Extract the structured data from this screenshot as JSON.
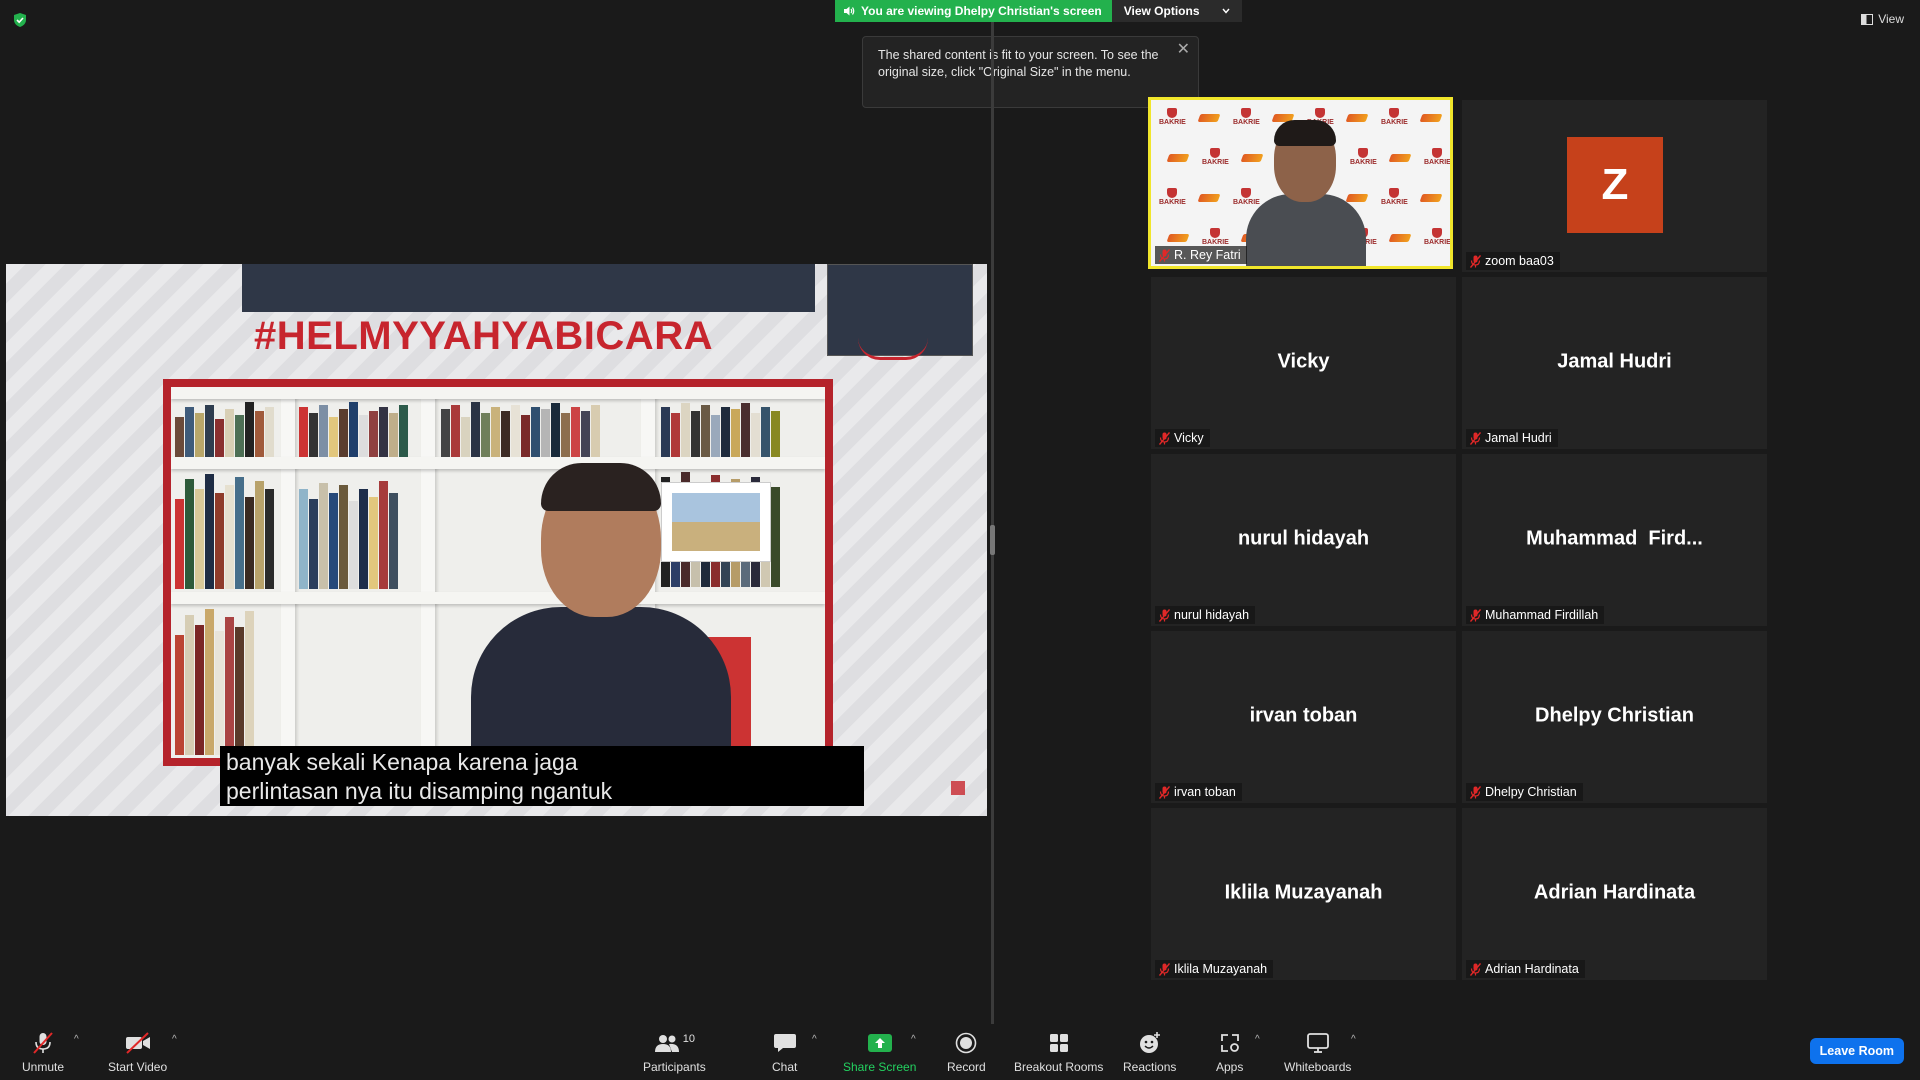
{
  "top": {
    "viewing_text": "You are viewing Dhelpy Christian's screen",
    "view_options_label": "View Options",
    "view_label": "View",
    "accent_green": "#23b14d"
  },
  "tooltip": {
    "text": "The shared content is fit to your screen. To see the original size, click \"Original Size\" in the menu."
  },
  "shared_screen": {
    "hashtag": "#HELMYYAHYABICARA",
    "caption_line1": "banyak sekali Kenapa karena jaga",
    "caption_line2": "perlintasan nya itu disamping ngantuk",
    "accent_red": "#c7252e"
  },
  "gallery": {
    "tiles": [
      {
        "center_name": "",
        "label": "R. Rey Fatri",
        "active": true,
        "video": true
      },
      {
        "center_name": "",
        "label": "zoom baa03",
        "avatar_letter": "Z",
        "avatar_color": "#c6411b"
      },
      {
        "center_name": "Vicky",
        "label": "Vicky"
      },
      {
        "center_name": "Jamal Hudri",
        "label": "Jamal Hudri"
      },
      {
        "center_name": "nurul hidayah",
        "label": "nurul hidayah"
      },
      {
        "center_name": "Muhammad  Fird...",
        "label": "Muhammad Firdillah"
      },
      {
        "center_name": "irvan toban",
        "label": "irvan toban"
      },
      {
        "center_name": "Dhelpy Christian",
        "label": "Dhelpy Christian"
      },
      {
        "center_name": "Iklila Muzayanah",
        "label": "Iklila Muzayanah"
      },
      {
        "center_name": "Adrian Hardinata",
        "label": "Adrian Hardinata"
      }
    ],
    "bakrie_logo_text": "BAKRIE"
  },
  "toolbar": {
    "unmute": "Unmute",
    "start_video": "Start Video",
    "participants": "Participants",
    "participants_count": "10",
    "chat": "Chat",
    "share_screen": "Share Screen",
    "record": "Record",
    "breakout_rooms": "Breakout Rooms",
    "reactions": "Reactions",
    "apps": "Apps",
    "whiteboards": "Whiteboards",
    "leave_room": "Leave Room",
    "share_green": "#23b14d",
    "leave_blue": "#0e72ed"
  }
}
